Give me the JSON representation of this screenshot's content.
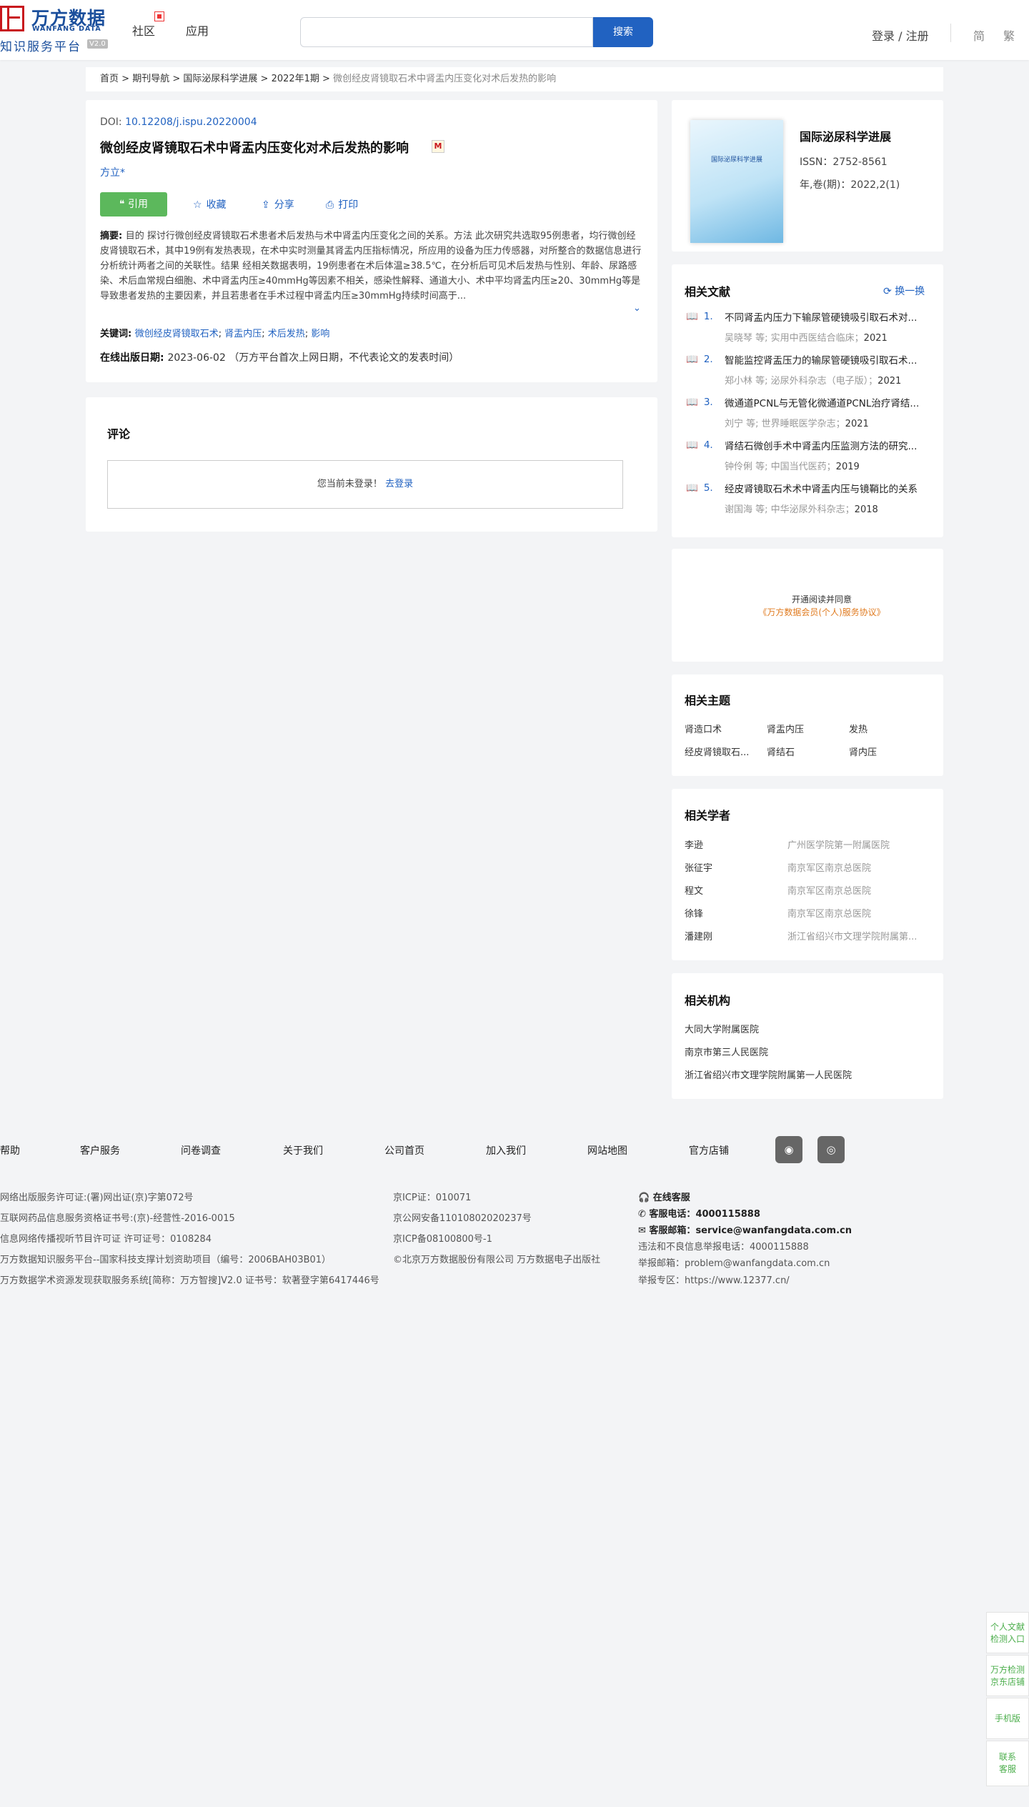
{
  "header": {
    "logo_cn": "万方数据",
    "logo_en": "WANFANG DATA",
    "logo_sub": "知识服务平台",
    "logo_ver": "V2.0",
    "nav": [
      "社区",
      "应用"
    ],
    "search_btn": "搜索",
    "search_placeholder": "",
    "login": "登录 / 注册",
    "lang": [
      "简",
      "繁"
    ]
  },
  "breadcrumb": {
    "items": [
      "首页",
      "期刊导航",
      "国际泌尿科学进展",
      "2022年1期"
    ],
    "sep": " > ",
    "current": "微创经皮肾镜取石术中肾盂内压变化对术后发热的影响"
  },
  "article": {
    "doi_label": "DOI: ",
    "doi": "10.12208/j.ispu.20220004",
    "title": "微创经皮肾镜取石术中肾盂内压变化对术后发热的影响",
    "micon": "M",
    "author": "方立*",
    "actions": {
      "cite": "引用",
      "fav": "收藏",
      "share": "分享",
      "print": "打印"
    },
    "abstract_label": "摘要: ",
    "abstract": "目的 探讨行微创经皮肾镜取石术患者术后发热与术中肾盂内压变化之间的关系。方法 此次研究共选取95例患者，均行微创经皮肾镜取石术，其中19例有发热表现，在术中实时测量其肾盂内压指标情况，所应用的设备为压力传感器，对所整合的数据信息进行分析统计两者之间的关联性。结果 经相关数据表明，19例患者在术后体温≥38.5℃，在分析后可见术后发热与性别、年龄、尿路感染、术后血常规白细胞、术中肾盂内压≥40mmHg等因素不相关，感染性解释、通道大小、术中平均肾盂内压≥20、30mmHg等是导致患者发热的主要因素，并且若患者在手术过程中肾盂内压≥30mmHg持续时间高于...",
    "keywords_label": "关键词: ",
    "keywords": [
      "微创经皮肾镜取石术",
      "肾盂内压",
      "术后发热",
      "影响"
    ],
    "pub_label": "在线出版日期: ",
    "pub_date": "2023-06-02",
    "pub_note": "（万方平台首次上网日期，不代表论文的发表时间）"
  },
  "comments": {
    "title": "评论",
    "notice": "您当前未登录！",
    "login_link": "去登录"
  },
  "journal": {
    "cover_text": "国际泌尿科学进展",
    "name": "国际泌尿科学进展",
    "issn": "ISSN：2752-8561",
    "issue": "年,卷(期)：2022,2(1)"
  },
  "related_docs": {
    "title": "相关文献",
    "swap": "换一换",
    "items": [
      {
        "num": "1.",
        "title": "不同肾盂内压力下输尿管硬镜吸引取石术对...",
        "authors": "吴晓琴  等;",
        "source": "实用中西医结合临床；",
        "year": "2021"
      },
      {
        "num": "2.",
        "title": "智能监控肾盂压力的输尿管硬镜吸引取石术...",
        "authors": "郑小林  等;",
        "source": "泌尿外科杂志（电子版）；",
        "year": "2021"
      },
      {
        "num": "3.",
        "title": "微通道PCNL与无管化微通道PCNL治疗肾结...",
        "authors": "刘宁  等;",
        "source": "世界睡眠医学杂志；",
        "year": "2021"
      },
      {
        "num": "4.",
        "title": "肾结石微创手术中肾盂内压监测方法的研究...",
        "authors": "钟伶俐  等;",
        "source": "中国当代医药；",
        "year": "2019"
      },
      {
        "num": "5.",
        "title": "经皮肾镜取石术术中肾盂内压与镜鞘比的关系",
        "authors": "谢国海  等;",
        "source": "中华泌尿外科杂志；",
        "year": "2018"
      }
    ]
  },
  "agreement": {
    "line1": "开通阅读并同意",
    "line2": "《万方数据会员(个人)服务协议》"
  },
  "topics": {
    "title": "相关主题",
    "items": [
      "肾造口术",
      "肾盂内压",
      "发热",
      "经皮肾镜取石...",
      "肾结石",
      "肾内压"
    ]
  },
  "scholars": {
    "title": "相关学者",
    "items": [
      {
        "name": "李逊",
        "org": "广州医学院第一附属医院"
      },
      {
        "name": "张征宇",
        "org": "南京军区南京总医院"
      },
      {
        "name": "程文",
        "org": "南京军区南京总医院"
      },
      {
        "name": "徐锋",
        "org": "南京军区南京总医院"
      },
      {
        "name": "潘建刚",
        "org": "浙江省绍兴市文理学院附属第..."
      }
    ]
  },
  "institutions": {
    "title": "相关机构",
    "items": [
      "大同大学附属医院",
      "南京市第三人民医院",
      "浙江省绍兴市文理学院附属第一人民医院"
    ]
  },
  "footer": {
    "links": [
      "帮助",
      "客户服务",
      "问卷调查",
      "关于我们",
      "公司首页",
      "加入我们",
      "网站地图",
      "官方店铺"
    ],
    "social": [
      "微博",
      "微信"
    ],
    "col1": [
      "网络出版服务许可证:(署)网出证(京)字第072号",
      "互联网药品信息服务资格证书号:(京)-经营性-2016-0015",
      "信息网络传播视听节目许可证 许可证号：0108284",
      "万方数据知识服务平台--国家科技支撑计划资助项目（编号：2006BAH03B01）",
      "万方数据学术资源发现获取服务系统[简称：万方智搜]V2.0 证书号：软著登字第6417446号"
    ],
    "col2": [
      "京ICP证：010071",
      "京公网安备11010802020237号",
      "京ICP备08100800号-1",
      "©北京万方数据股份有限公司 万方数据电子出版社"
    ],
    "col3": {
      "online": "在线客服",
      "phone_label": "客服电话：",
      "phone": "4000115888",
      "email_label": "客服邮箱：",
      "email": "service@wanfangdata.com.cn",
      "report_phone": "违法和不良信息举报电话：4000115888",
      "report_email": "举报邮箱：problem@wanfangdata.com.cn",
      "report_zone": "举报专区：https://www.12377.cn/"
    }
  },
  "sidebar": {
    "items": [
      "个人文献\n检测入口",
      "万方检测\n京东店铺",
      "手机版",
      "联系\n客服"
    ]
  },
  "colors": {
    "primary": "#2162c1",
    "cite_green": "#5cb85c",
    "brand_red": "#c8161d",
    "agreement_orange": "#e07b20"
  }
}
